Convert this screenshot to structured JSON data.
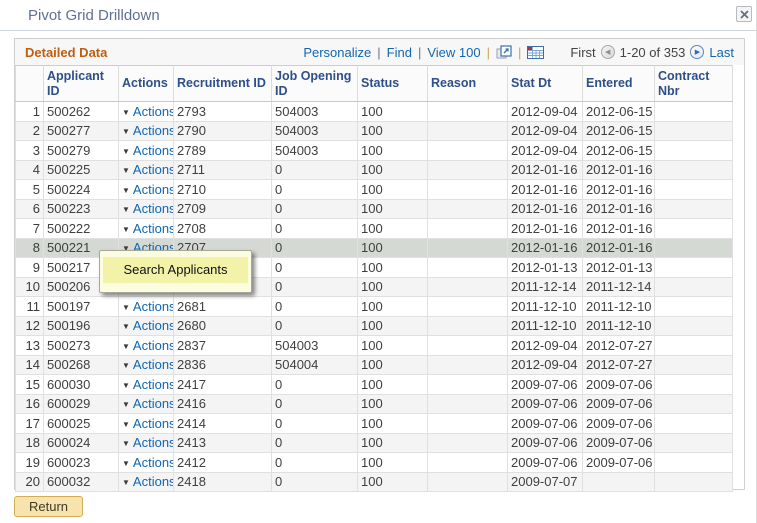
{
  "window": {
    "title": "Pivot Grid Drilldown"
  },
  "toolbar": {
    "grid_title": "Detailed Data",
    "links": [
      "Personalize",
      "Find",
      "View 100"
    ],
    "pagination": {
      "first": "First",
      "range": "1-20 of 353",
      "last": "Last"
    }
  },
  "table": {
    "columns": [
      "Applicant ID",
      "Actions",
      "Recruitment ID",
      "Job Opening ID",
      "Status",
      "Reason",
      "Stat Dt",
      "Entered",
      "Contract Nbr"
    ],
    "selected_index": 7,
    "rows": [
      {
        "num": "1",
        "applicant_id": "500262",
        "actions": "Actions",
        "recruitment_id": "2793",
        "job_opening_id": "504003",
        "status": "100",
        "reason": "",
        "stat_dt": "2012-09-04",
        "entered": "2012-06-15",
        "contract_nbr": ""
      },
      {
        "num": "2",
        "applicant_id": "500277",
        "actions": "Actions",
        "recruitment_id": "2790",
        "job_opening_id": "504003",
        "status": "100",
        "reason": "",
        "stat_dt": "2012-09-04",
        "entered": "2012-06-15",
        "contract_nbr": ""
      },
      {
        "num": "3",
        "applicant_id": "500279",
        "actions": "Actions",
        "recruitment_id": "2789",
        "job_opening_id": "504003",
        "status": "100",
        "reason": "",
        "stat_dt": "2012-09-04",
        "entered": "2012-06-15",
        "contract_nbr": ""
      },
      {
        "num": "4",
        "applicant_id": "500225",
        "actions": "Actions",
        "recruitment_id": "2711",
        "job_opening_id": "0",
        "status": "100",
        "reason": "",
        "stat_dt": "2012-01-16",
        "entered": "2012-01-16",
        "contract_nbr": ""
      },
      {
        "num": "5",
        "applicant_id": "500224",
        "actions": "Actions",
        "recruitment_id": "2710",
        "job_opening_id": "0",
        "status": "100",
        "reason": "",
        "stat_dt": "2012-01-16",
        "entered": "2012-01-16",
        "contract_nbr": ""
      },
      {
        "num": "6",
        "applicant_id": "500223",
        "actions": "Actions",
        "recruitment_id": "2709",
        "job_opening_id": "0",
        "status": "100",
        "reason": "",
        "stat_dt": "2012-01-16",
        "entered": "2012-01-16",
        "contract_nbr": ""
      },
      {
        "num": "7",
        "applicant_id": "500222",
        "actions": "Actions",
        "recruitment_id": "2708",
        "job_opening_id": "0",
        "status": "100",
        "reason": "",
        "stat_dt": "2012-01-16",
        "entered": "2012-01-16",
        "contract_nbr": ""
      },
      {
        "num": "8",
        "applicant_id": "500221",
        "actions": "Actions",
        "recruitment_id": "2707",
        "job_opening_id": "0",
        "status": "100",
        "reason": "",
        "stat_dt": "2012-01-16",
        "entered": "2012-01-16",
        "contract_nbr": ""
      },
      {
        "num": "9",
        "applicant_id": "500217",
        "actions": "",
        "recruitment_id": "",
        "job_opening_id": "0",
        "status": "100",
        "reason": "",
        "stat_dt": "2012-01-13",
        "entered": "2012-01-13",
        "contract_nbr": ""
      },
      {
        "num": "10",
        "applicant_id": "500206",
        "actions": "",
        "recruitment_id": "",
        "job_opening_id": "0",
        "status": "100",
        "reason": "",
        "stat_dt": "2011-12-14",
        "entered": "2011-12-14",
        "contract_nbr": ""
      },
      {
        "num": "11",
        "applicant_id": "500197",
        "actions": "Actions",
        "recruitment_id": "2681",
        "job_opening_id": "0",
        "status": "100",
        "reason": "",
        "stat_dt": "2011-12-10",
        "entered": "2011-12-10",
        "contract_nbr": ""
      },
      {
        "num": "12",
        "applicant_id": "500196",
        "actions": "Actions",
        "recruitment_id": "2680",
        "job_opening_id": "0",
        "status": "100",
        "reason": "",
        "stat_dt": "2011-12-10",
        "entered": "2011-12-10",
        "contract_nbr": ""
      },
      {
        "num": "13",
        "applicant_id": "500273",
        "actions": "Actions",
        "recruitment_id": "2837",
        "job_opening_id": "504003",
        "status": "100",
        "reason": "",
        "stat_dt": "2012-09-04",
        "entered": "2012-07-27",
        "contract_nbr": ""
      },
      {
        "num": "14",
        "applicant_id": "500268",
        "actions": "Actions",
        "recruitment_id": "2836",
        "job_opening_id": "504004",
        "status": "100",
        "reason": "",
        "stat_dt": "2012-09-04",
        "entered": "2012-07-27",
        "contract_nbr": ""
      },
      {
        "num": "15",
        "applicant_id": "600030",
        "actions": "Actions",
        "recruitment_id": "2417",
        "job_opening_id": "0",
        "status": "100",
        "reason": "",
        "stat_dt": "2009-07-06",
        "entered": "2009-07-06",
        "contract_nbr": ""
      },
      {
        "num": "16",
        "applicant_id": "600029",
        "actions": "Actions",
        "recruitment_id": "2416",
        "job_opening_id": "0",
        "status": "100",
        "reason": "",
        "stat_dt": "2009-07-06",
        "entered": "2009-07-06",
        "contract_nbr": ""
      },
      {
        "num": "17",
        "applicant_id": "600025",
        "actions": "Actions",
        "recruitment_id": "2414",
        "job_opening_id": "0",
        "status": "100",
        "reason": "",
        "stat_dt": "2009-07-06",
        "entered": "2009-07-06",
        "contract_nbr": ""
      },
      {
        "num": "18",
        "applicant_id": "600024",
        "actions": "Actions",
        "recruitment_id": "2413",
        "job_opening_id": "0",
        "status": "100",
        "reason": "",
        "stat_dt": "2009-07-06",
        "entered": "2009-07-06",
        "contract_nbr": ""
      },
      {
        "num": "19",
        "applicant_id": "600023",
        "actions": "Actions",
        "recruitment_id": "2412",
        "job_opening_id": "0",
        "status": "100",
        "reason": "",
        "stat_dt": "2009-07-06",
        "entered": "2009-07-06",
        "contract_nbr": ""
      },
      {
        "num": "20",
        "applicant_id": "600032",
        "actions": "Actions",
        "recruitment_id": "2418",
        "job_opening_id": "0",
        "status": "100",
        "reason": "",
        "stat_dt": "2009-07-07",
        "entered": "",
        "contract_nbr": ""
      }
    ]
  },
  "popup": {
    "items": [
      "Search Applicants"
    ]
  },
  "footer": {
    "return_label": "Return"
  },
  "colors": {
    "accent_orange": "#c05e10",
    "link_blue": "#1166b2",
    "header_navy": "#2d4f8a",
    "selected_row": "#d5d9d3",
    "popup_yellow": "#f2f2a8",
    "button_tan": "#f7e3ad"
  }
}
